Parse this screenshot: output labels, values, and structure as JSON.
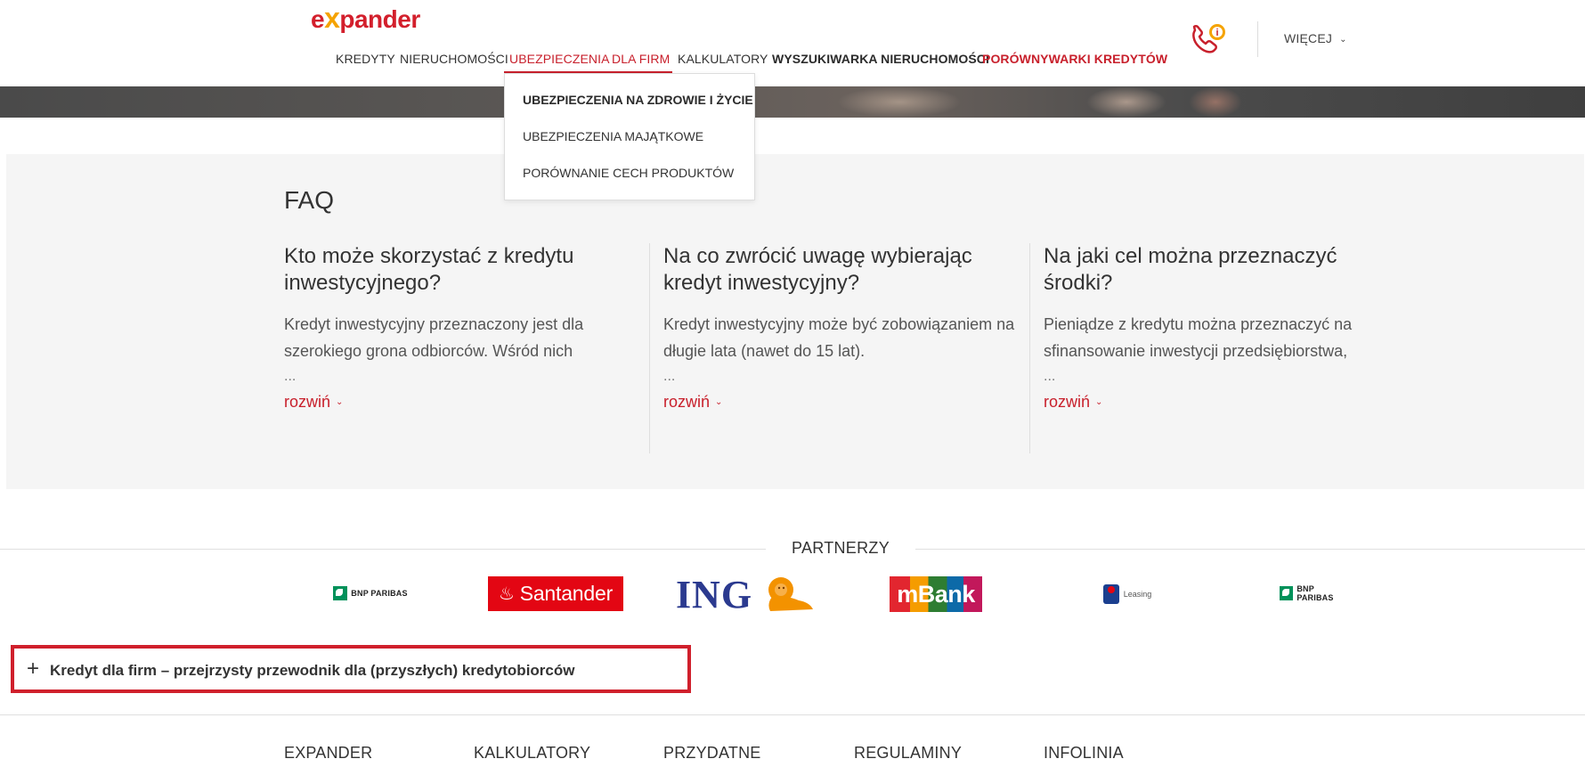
{
  "header": {
    "logo_pre": "e",
    "logo_x": "x",
    "logo_post": "pander",
    "nav": [
      {
        "label": "KREDYTY"
      },
      {
        "label": "NIERUCHOMOŚCI"
      },
      {
        "label": "UBEZPIECZENIA"
      },
      {
        "label": "DLA FIRM"
      },
      {
        "label": "KALKULATORY"
      },
      {
        "label": "WYSZUKIWARKA NIERUCHOMOŚCI"
      },
      {
        "label": "PORÓWNYWARKI KREDYTÓW"
      }
    ],
    "more_label": "WIĘCEJ",
    "phone_badge": "i"
  },
  "dropdown": {
    "items": [
      {
        "label": "UBEZPIECZENIA NA ZDROWIE I ŻYCIE"
      },
      {
        "label": "UBEZPIECZENIA MAJĄTKOWE"
      },
      {
        "label": "PORÓWNANIE CECH PRODUKTÓW"
      }
    ]
  },
  "faq": {
    "title": "FAQ",
    "items": [
      {
        "question": "Kto może skorzystać z kredytu inwestycyjnego?",
        "answer": "Kredyt inwestycyjny przeznaczony jest dla szerokiego grona odbiorców. Wśród nich",
        "ellipsis": "...",
        "more": "rozwiń"
      },
      {
        "question": "Na co zwrócić uwagę wybierając kredyt inwestycyjny?",
        "answer": "Kredyt inwestycyjny może być zobowiązaniem na długie lata (nawet do 15 lat).",
        "ellipsis": "...",
        "more": "rozwiń"
      },
      {
        "question": "Na jaki cel można przeznaczyć środki?",
        "answer": "Pieniądze z kredytu można przeznaczyć na sfinansowanie inwestycji przedsiębiorstwa,",
        "ellipsis": "...",
        "more": "rozwiń"
      }
    ]
  },
  "partners": {
    "title": "PARTNERZY",
    "logos": [
      {
        "name": "BNP PARIBAS"
      },
      {
        "name": "Santander"
      },
      {
        "name": "ING"
      },
      {
        "name": "mBank"
      },
      {
        "name": "Leasing"
      },
      {
        "name": "BNP PARIBAS"
      }
    ]
  },
  "accordion": {
    "icon": "+",
    "title": "Kredyt dla firm – przejrzysty przewodnik dla (przyszłych) kredytobiorców"
  },
  "footer": {
    "columns": [
      "EXPANDER",
      "KALKULATORY",
      "PRZYDATNE",
      "REGULAMINY",
      "INFOLINIA"
    ]
  },
  "colors": {
    "brand_red": "#c8202c",
    "logo_orange": "#f5a300",
    "faq_bg": "#f5f5f5"
  }
}
